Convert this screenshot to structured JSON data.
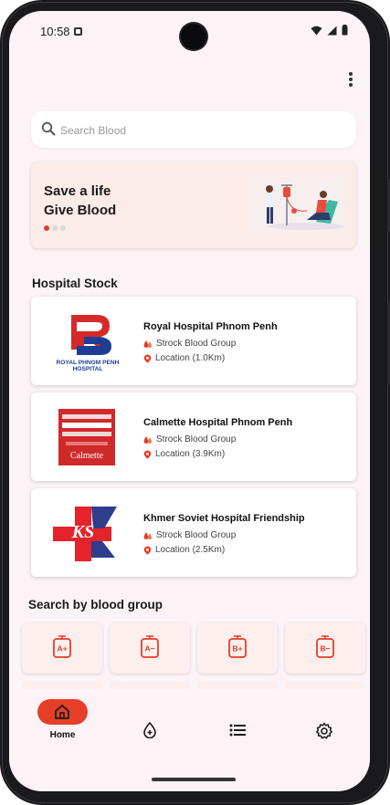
{
  "status_bar": {
    "time": "10:58"
  },
  "search": {
    "placeholder": "Search Blood"
  },
  "banner": {
    "line1": "Save a life",
    "line2": "Give Blood",
    "slides": 3,
    "active_slide": 1
  },
  "hospital_stock": {
    "title": "Hospital Stock",
    "hospitals": [
      {
        "name": "Royal Hospital Phnom Penh",
        "group_label": "Strock Blood Group",
        "location": "Location (1.0Km)",
        "logo_text": "ROYAL PHNOM PENH HOSPITAL"
      },
      {
        "name": "Calmette Hospital Phnom Penh",
        "group_label": "Strock Blood Group",
        "location": "Location (3.9Km)",
        "logo_text": "Calmette"
      },
      {
        "name": "Khmer Soviet Hospital Friendship",
        "group_label": "Strock Blood Group",
        "location": "Location (2.5Km)",
        "logo_text": "KS"
      }
    ]
  },
  "blood_groups": {
    "title": "Search by blood group",
    "items": [
      "A+",
      "A−",
      "B+",
      "B−"
    ]
  },
  "bottom_nav": {
    "items": [
      {
        "label": "Home",
        "icon": "home-icon",
        "active": true
      },
      {
        "label": "",
        "icon": "blood-drop-add-icon"
      },
      {
        "label": "",
        "icon": "list-icon"
      },
      {
        "label": "",
        "icon": "settings-gear-icon"
      }
    ]
  },
  "colors": {
    "accent": "#e53f2a",
    "bg": "#fcf3f7",
    "banner": "#fbece8",
    "tile": "#fcefee"
  }
}
